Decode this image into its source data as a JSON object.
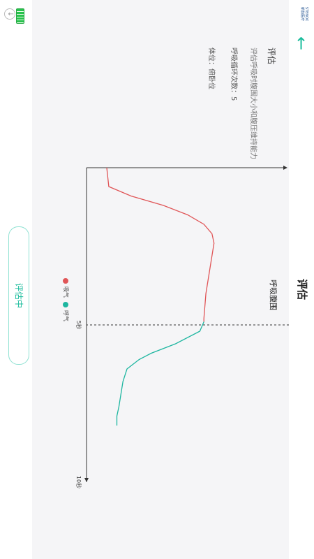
{
  "header": {
    "title": "评估",
    "logo_text": "STENOX 新韵医疗",
    "back_icon": "arrow-left-icon"
  },
  "status": {
    "battery_icon": "battery-icon",
    "download_icon": "download-icon"
  },
  "info": {
    "section_title": "评估",
    "description": "评估呼吸时腹围大小和腹压维持能力",
    "cycles_label": "呼吸循环次数：5",
    "posture_label": "体位：俯卧位"
  },
  "chart_data": {
    "type": "line",
    "title": "呼吸腹围",
    "xlabel": "",
    "ylabel": "",
    "x_ticks": [
      "5秒",
      "10秒"
    ],
    "xlim": [
      0,
      10
    ],
    "grid": false,
    "legend_placement": "bottom",
    "colors": {
      "inhale": "#e05557",
      "exhale": "#1db6a0"
    },
    "series": [
      {
        "name": "吸气",
        "x": [
          0,
          0.6,
          0.9,
          1.2,
          1.5,
          1.8,
          2.1,
          2.4,
          3.2,
          4.0,
          4.8,
          4.9
        ],
        "y": [
          0.1,
          0.11,
          0.22,
          0.38,
          0.5,
          0.58,
          0.62,
          0.63,
          0.61,
          0.59,
          0.58,
          0.58
        ]
      },
      {
        "name": "呼气",
        "x": [
          4.9,
          5.2,
          5.6,
          5.9,
          6.1,
          6.4,
          6.8,
          7.2,
          7.6,
          7.9,
          8.2
        ],
        "y": [
          0.58,
          0.56,
          0.44,
          0.32,
          0.26,
          0.2,
          0.18,
          0.17,
          0.16,
          0.15,
          0.15
        ]
      }
    ]
  },
  "legend": {
    "inhale_label": "吸气",
    "exhale_label": "呼气"
  },
  "action": {
    "button_label": "评估中"
  }
}
